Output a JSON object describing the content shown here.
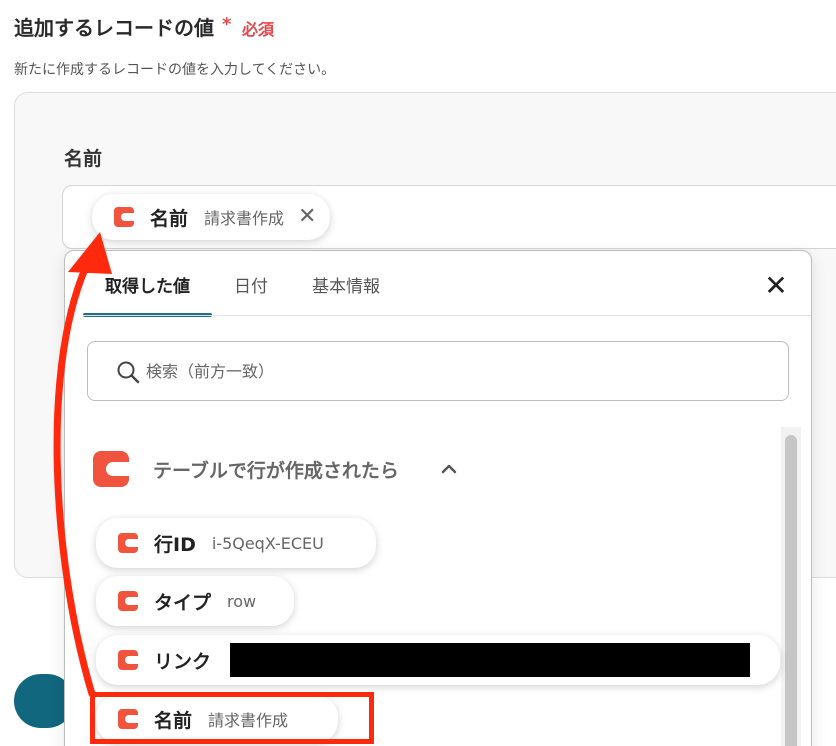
{
  "section": {
    "title": "追加するレコードの値",
    "required_mark": "*",
    "required_label": "必須",
    "description": "新たに作成するレコードの値を入力してください。"
  },
  "field": {
    "label": "名前",
    "selected_chip": {
      "label": "名前",
      "value": "請求書作成",
      "remove_glyph": "✕",
      "icon": "coda-icon"
    }
  },
  "popup": {
    "tabs": [
      {
        "label": "取得した値",
        "active": true
      },
      {
        "label": "日付",
        "active": false
      },
      {
        "label": "基本情報",
        "active": false
      }
    ],
    "close_glyph": "✕",
    "search": {
      "placeholder": "検索（前方一致）",
      "value": ""
    },
    "group": {
      "label": "テーブルで行が作成されたら",
      "chevron": "^",
      "icon": "coda-icon"
    },
    "items": [
      {
        "label": "行ID",
        "value": "i-5QeqX-ECEU"
      },
      {
        "label": "タイプ",
        "value": "row"
      },
      {
        "label": "リンク",
        "value": ""
      },
      {
        "label": "名前",
        "value": "請求書作成"
      }
    ]
  },
  "colors": {
    "accent": "#1c6f8a",
    "required": "#e5484d",
    "annotation": "#ff2a0e",
    "app_icon": "#f0533e"
  }
}
